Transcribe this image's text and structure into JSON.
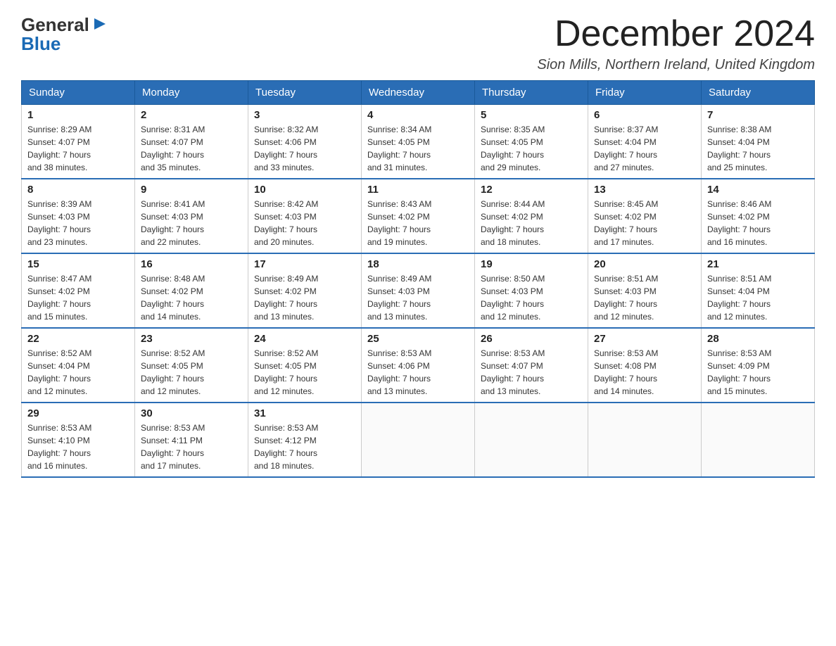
{
  "logo": {
    "general": "General",
    "blue": "Blue",
    "arrow": "▶"
  },
  "title": "December 2024",
  "location": "Sion Mills, Northern Ireland, United Kingdom",
  "days_of_week": [
    "Sunday",
    "Monday",
    "Tuesday",
    "Wednesday",
    "Thursday",
    "Friday",
    "Saturday"
  ],
  "weeks": [
    [
      {
        "day": "1",
        "sunrise": "8:29 AM",
        "sunset": "4:07 PM",
        "daylight": "7 hours and 38 minutes."
      },
      {
        "day": "2",
        "sunrise": "8:31 AM",
        "sunset": "4:07 PM",
        "daylight": "7 hours and 35 minutes."
      },
      {
        "day": "3",
        "sunrise": "8:32 AM",
        "sunset": "4:06 PM",
        "daylight": "7 hours and 33 minutes."
      },
      {
        "day": "4",
        "sunrise": "8:34 AM",
        "sunset": "4:05 PM",
        "daylight": "7 hours and 31 minutes."
      },
      {
        "day": "5",
        "sunrise": "8:35 AM",
        "sunset": "4:05 PM",
        "daylight": "7 hours and 29 minutes."
      },
      {
        "day": "6",
        "sunrise": "8:37 AM",
        "sunset": "4:04 PM",
        "daylight": "7 hours and 27 minutes."
      },
      {
        "day": "7",
        "sunrise": "8:38 AM",
        "sunset": "4:04 PM",
        "daylight": "7 hours and 25 minutes."
      }
    ],
    [
      {
        "day": "8",
        "sunrise": "8:39 AM",
        "sunset": "4:03 PM",
        "daylight": "7 hours and 23 minutes."
      },
      {
        "day": "9",
        "sunrise": "8:41 AM",
        "sunset": "4:03 PM",
        "daylight": "7 hours and 22 minutes."
      },
      {
        "day": "10",
        "sunrise": "8:42 AM",
        "sunset": "4:03 PM",
        "daylight": "7 hours and 20 minutes."
      },
      {
        "day": "11",
        "sunrise": "8:43 AM",
        "sunset": "4:02 PM",
        "daylight": "7 hours and 19 minutes."
      },
      {
        "day": "12",
        "sunrise": "8:44 AM",
        "sunset": "4:02 PM",
        "daylight": "7 hours and 18 minutes."
      },
      {
        "day": "13",
        "sunrise": "8:45 AM",
        "sunset": "4:02 PM",
        "daylight": "7 hours and 17 minutes."
      },
      {
        "day": "14",
        "sunrise": "8:46 AM",
        "sunset": "4:02 PM",
        "daylight": "7 hours and 16 minutes."
      }
    ],
    [
      {
        "day": "15",
        "sunrise": "8:47 AM",
        "sunset": "4:02 PM",
        "daylight": "7 hours and 15 minutes."
      },
      {
        "day": "16",
        "sunrise": "8:48 AM",
        "sunset": "4:02 PM",
        "daylight": "7 hours and 14 minutes."
      },
      {
        "day": "17",
        "sunrise": "8:49 AM",
        "sunset": "4:02 PM",
        "daylight": "7 hours and 13 minutes."
      },
      {
        "day": "18",
        "sunrise": "8:49 AM",
        "sunset": "4:03 PM",
        "daylight": "7 hours and 13 minutes."
      },
      {
        "day": "19",
        "sunrise": "8:50 AM",
        "sunset": "4:03 PM",
        "daylight": "7 hours and 12 minutes."
      },
      {
        "day": "20",
        "sunrise": "8:51 AM",
        "sunset": "4:03 PM",
        "daylight": "7 hours and 12 minutes."
      },
      {
        "day": "21",
        "sunrise": "8:51 AM",
        "sunset": "4:04 PM",
        "daylight": "7 hours and 12 minutes."
      }
    ],
    [
      {
        "day": "22",
        "sunrise": "8:52 AM",
        "sunset": "4:04 PM",
        "daylight": "7 hours and 12 minutes."
      },
      {
        "day": "23",
        "sunrise": "8:52 AM",
        "sunset": "4:05 PM",
        "daylight": "7 hours and 12 minutes."
      },
      {
        "day": "24",
        "sunrise": "8:52 AM",
        "sunset": "4:05 PM",
        "daylight": "7 hours and 12 minutes."
      },
      {
        "day": "25",
        "sunrise": "8:53 AM",
        "sunset": "4:06 PM",
        "daylight": "7 hours and 13 minutes."
      },
      {
        "day": "26",
        "sunrise": "8:53 AM",
        "sunset": "4:07 PM",
        "daylight": "7 hours and 13 minutes."
      },
      {
        "day": "27",
        "sunrise": "8:53 AM",
        "sunset": "4:08 PM",
        "daylight": "7 hours and 14 minutes."
      },
      {
        "day": "28",
        "sunrise": "8:53 AM",
        "sunset": "4:09 PM",
        "daylight": "7 hours and 15 minutes."
      }
    ],
    [
      {
        "day": "29",
        "sunrise": "8:53 AM",
        "sunset": "4:10 PM",
        "daylight": "7 hours and 16 minutes."
      },
      {
        "day": "30",
        "sunrise": "8:53 AM",
        "sunset": "4:11 PM",
        "daylight": "7 hours and 17 minutes."
      },
      {
        "day": "31",
        "sunrise": "8:53 AM",
        "sunset": "4:12 PM",
        "daylight": "7 hours and 18 minutes."
      },
      null,
      null,
      null,
      null
    ]
  ],
  "labels": {
    "sunrise": "Sunrise:",
    "sunset": "Sunset:",
    "daylight": "Daylight:"
  }
}
